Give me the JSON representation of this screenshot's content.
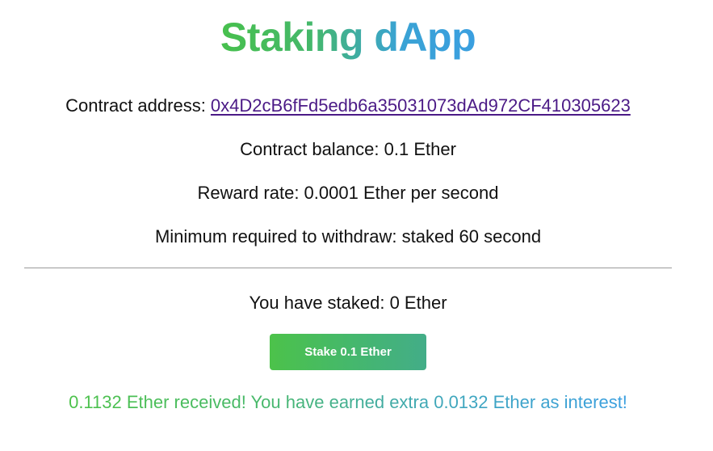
{
  "header": {
    "title": "Staking dApp"
  },
  "contract": {
    "address_label": "Contract address: ",
    "address": "0x4D2cB6fFd5edb6a35031073dAd972CF410305623",
    "balance_text": "Contract balance: 0.1 Ether",
    "reward_rate_text": "Reward rate: 0.0001 Ether per second",
    "min_withdraw_text": "Minimum required to withdraw: staked 60 second"
  },
  "user": {
    "staked_text": "You have staked: 0 Ether"
  },
  "actions": {
    "stake_label": "Stake 0.1 Ether"
  },
  "status": {
    "message": "0.1132 Ether received! You have earned extra 0.0132 Ether as interest!"
  },
  "colors": {
    "gradient_green": "#4cc24a",
    "gradient_blue": "#3a9fe0",
    "link": "#4b1a86",
    "divider": "#9a9a9a"
  }
}
